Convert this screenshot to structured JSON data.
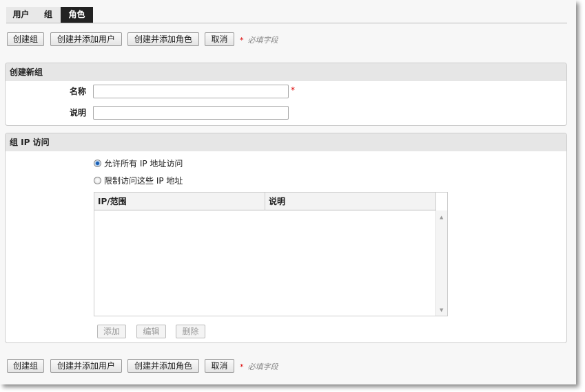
{
  "tabs": [
    {
      "label": "用户"
    },
    {
      "label": "组"
    },
    {
      "label": "角色",
      "active": true
    }
  ],
  "actions": {
    "create_group": "创建组",
    "create_add_user": "创建并添加用户",
    "create_add_role": "创建并添加角色",
    "cancel": "取消",
    "required_star": "*",
    "required_note": "必填字段"
  },
  "create_panel": {
    "title": "创建新组",
    "name_label": "名称",
    "name_value": "",
    "name_required": "*",
    "desc_label": "说明",
    "desc_value": ""
  },
  "ip_panel": {
    "title": "组 IP 访问",
    "radio_all": "允许所有 IP 地址访问",
    "radio_restrict": "限制访问这些 IP 地址",
    "selected": "all",
    "columns": [
      "IP/范围",
      "说明"
    ],
    "rows": [],
    "add": "添加",
    "edit": "编辑",
    "delete": "删除"
  }
}
